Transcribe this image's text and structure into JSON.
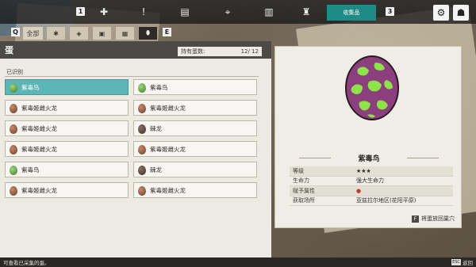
{
  "topbar": {
    "left_key": "1",
    "right_key": "3",
    "tabs": [
      {
        "icon": "journal-icon"
      },
      {
        "icon": "alert-icon"
      },
      {
        "icon": "book-icon"
      },
      {
        "icon": "map-icon"
      },
      {
        "icon": "notebook-icon"
      },
      {
        "icon": "statue-icon"
      }
    ],
    "active_tab_label": "收集品",
    "settings_icon": "gear-icon",
    "corner_icon": "party-icon"
  },
  "categories": {
    "left_key": "Q",
    "right_key": "E",
    "items": [
      {
        "label": "全部",
        "icon": "all-icon"
      },
      {
        "label": "",
        "icon": "bug-icon"
      },
      {
        "label": "",
        "icon": "tag-icon"
      },
      {
        "label": "",
        "icon": "box-icon"
      },
      {
        "label": "",
        "icon": "chest-icon"
      },
      {
        "label": "",
        "icon": "egg-icon"
      }
    ]
  },
  "panel": {
    "title": "蛋",
    "owned_label": "持有蛋数:",
    "owned_value": "12/ 12",
    "group_label": "已识别"
  },
  "eggs": [
    {
      "name": "紫毒鸟",
      "color": "green",
      "selected": true
    },
    {
      "name": "紫毒鸟",
      "color": "green",
      "selected": false
    },
    {
      "name": "紫毒姬雌火龙",
      "color": "brown",
      "selected": false
    },
    {
      "name": "紫毒姬雌火龙",
      "color": "brown",
      "selected": false
    },
    {
      "name": "紫毒姬雌火龙",
      "color": "brown",
      "selected": false
    },
    {
      "name": "棘龙",
      "color": "dark",
      "selected": false
    },
    {
      "name": "紫毒姬雌火龙",
      "color": "brown",
      "selected": false
    },
    {
      "name": "紫毒姬雌火龙",
      "color": "brown",
      "selected": false
    },
    {
      "name": "紫毒鸟",
      "color": "green",
      "selected": false
    },
    {
      "name": "棘龙",
      "color": "dark",
      "selected": false
    },
    {
      "name": "紫毒姬雌火龙",
      "color": "brown",
      "selected": false
    },
    {
      "name": "紫毒姬雌火龙",
      "color": "brown",
      "selected": false
    }
  ],
  "detail": {
    "name": "紫毒鸟",
    "egg_base_color": "#8b3f7c",
    "egg_spot_color": "#8ee24a",
    "stats": [
      {
        "label": "等级",
        "value": "★★★"
      },
      {
        "label": "生命力",
        "value": "强大生命力"
      },
      {
        "label": "赋予属性",
        "value": ""
      },
      {
        "label": "获取场所",
        "value": "亚兹拉尔地区(花阳平原)"
      }
    ],
    "hint_key": "F",
    "hint_text": "将蛋放回巢穴"
  },
  "bottom": {
    "status": "可查看已采集的蛋。",
    "back_key": "ESC",
    "back_label": "返回"
  }
}
